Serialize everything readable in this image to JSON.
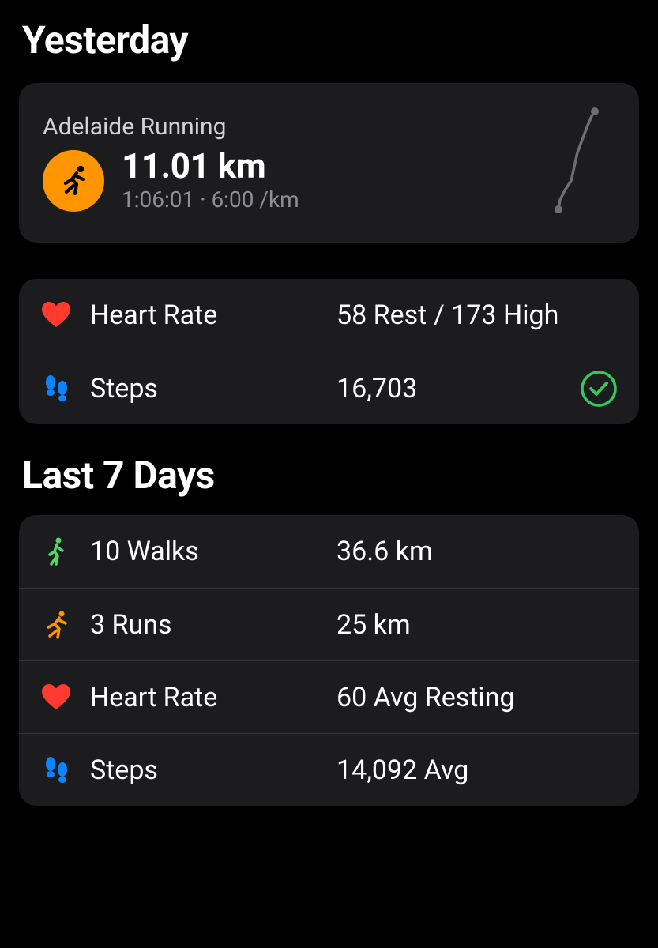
{
  "yesterday": {
    "title": "Yesterday",
    "workout": {
      "name": "Adelaide Running",
      "distance": "11.01 km",
      "duration": "1:06:01",
      "pace": "6:00 /km",
      "duration_pace": "1:06:01 · 6:00 /km"
    },
    "heart_rate": {
      "label": "Heart Rate",
      "value": "58 Rest / 173 High",
      "rest": 58,
      "high": 173
    },
    "steps": {
      "label": "Steps",
      "value": "16,703",
      "count": 16703,
      "goal_met": true
    }
  },
  "last7": {
    "title": "Last 7 Days",
    "walks": {
      "label": "10 Walks",
      "count": 10,
      "value": "36.6 km",
      "distance_km": 36.6
    },
    "runs": {
      "label": "3 Runs",
      "count": 3,
      "value": "25 km",
      "distance_km": 25
    },
    "heart_rate": {
      "label": "Heart Rate",
      "value": "60 Avg Resting",
      "avg_resting": 60
    },
    "steps": {
      "label": "Steps",
      "value": "14,092 Avg",
      "avg": 14092
    }
  },
  "colors": {
    "orange": "#ff9500",
    "red": "#ff3b30",
    "blue": "#0a84ff",
    "green": "#34c759",
    "green_walk": "#4cd964"
  }
}
